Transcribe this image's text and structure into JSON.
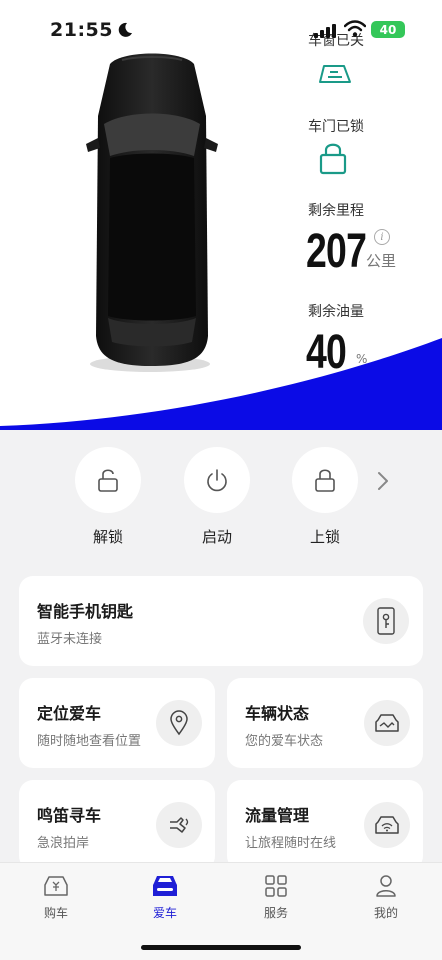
{
  "status_bar": {
    "time": "21:55",
    "battery": "40"
  },
  "vehicle": {
    "window_status": "车窗已关",
    "door_status": "车门已锁",
    "range_label": "剩余里程",
    "range_value": "207",
    "range_unit": "公里",
    "fuel_label": "剩余油量",
    "fuel_value": "40",
    "fuel_unit": "%"
  },
  "actions": [
    {
      "label": "解锁"
    },
    {
      "label": "启动"
    },
    {
      "label": "上锁"
    }
  ],
  "cards": {
    "phone_key": {
      "title": "智能手机钥匙",
      "subtitle": "蓝牙未连接"
    },
    "locate": {
      "title": "定位爱车",
      "subtitle": "随时随地查看位置"
    },
    "status": {
      "title": "车辆状态",
      "subtitle": "您的爱车状态"
    },
    "horn": {
      "title": "鸣笛寻车",
      "subtitle": "急浪拍岸"
    },
    "traffic": {
      "title": "流量管理",
      "subtitle": "让旅程随时在线"
    }
  },
  "tabs": [
    {
      "label": "购车"
    },
    {
      "label": "爱车"
    },
    {
      "label": "服务"
    },
    {
      "label": "我的"
    }
  ],
  "colors": {
    "accent": "#1f1fd6",
    "wave": "#0b0be6",
    "teal": "#1a9a88"
  }
}
